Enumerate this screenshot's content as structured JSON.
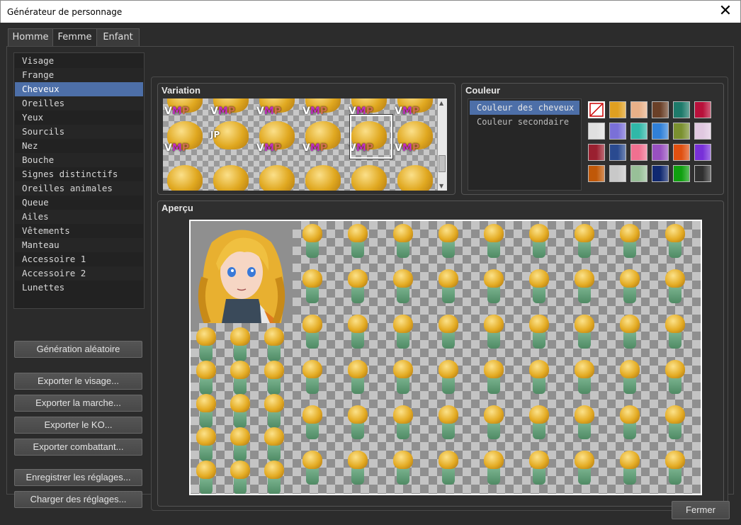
{
  "window": {
    "title": "Générateur de personnage",
    "close_glyph": "✕"
  },
  "tabs": [
    {
      "label": "Homme",
      "active": false
    },
    {
      "label": "Femme",
      "active": true
    },
    {
      "label": "Enfant",
      "active": false
    }
  ],
  "parts": {
    "selected_index": 2,
    "items": [
      "Visage",
      "Frange",
      "Cheveux",
      "Oreilles",
      "Yeux",
      "Sourcils",
      "Nez",
      "Bouche",
      "Signes distinctifs",
      "Oreilles animales",
      "Queue",
      "Ailes",
      "Vêtements",
      "Manteau",
      "Accessoire 1",
      "Accessoire 2",
      "Lunettes"
    ]
  },
  "buttons": {
    "random": "Génération aléatoire",
    "export_face": "Exporter le visage...",
    "export_walk": "Exporter la marche...",
    "export_ko": "Exporter le KO...",
    "export_battler": "Exporter combattant...",
    "save_settings": "Enregistrer les réglages...",
    "load_settings": "Charger des réglages...",
    "close": "Fermer"
  },
  "variation": {
    "title": "Variation",
    "tag_v": "V",
    "tag_m": "M",
    "tag_p": "P",
    "tag_jp": "JP",
    "selected_index": 10
  },
  "couleur": {
    "title": "Couleur",
    "items": [
      "Couleur des cheveux",
      "Couleur secondaire"
    ],
    "selected_index": 0,
    "swatches": [
      [
        "none",
        "#e0a020",
        "#e8b088",
        "#6a4028",
        "#1e7a6a",
        "#b8103a"
      ],
      [
        "#e0e0e0",
        "#7a70d8",
        "#30b8a8",
        "#3080d8",
        "#7a9030",
        "#e0c8e0"
      ],
      [
        "#9a2030",
        "#2a4a90",
        "#f07090",
        "#9850c0",
        "#e05010",
        "#7830d8"
      ],
      [
        "#c05808",
        "#c8c8c8",
        "#98c098",
        "#102870",
        "#10a010",
        "#303030"
      ]
    ],
    "swatch_icons": [
      "no-color-icon"
    ]
  },
  "apercu": {
    "title": "Aperçu"
  }
}
